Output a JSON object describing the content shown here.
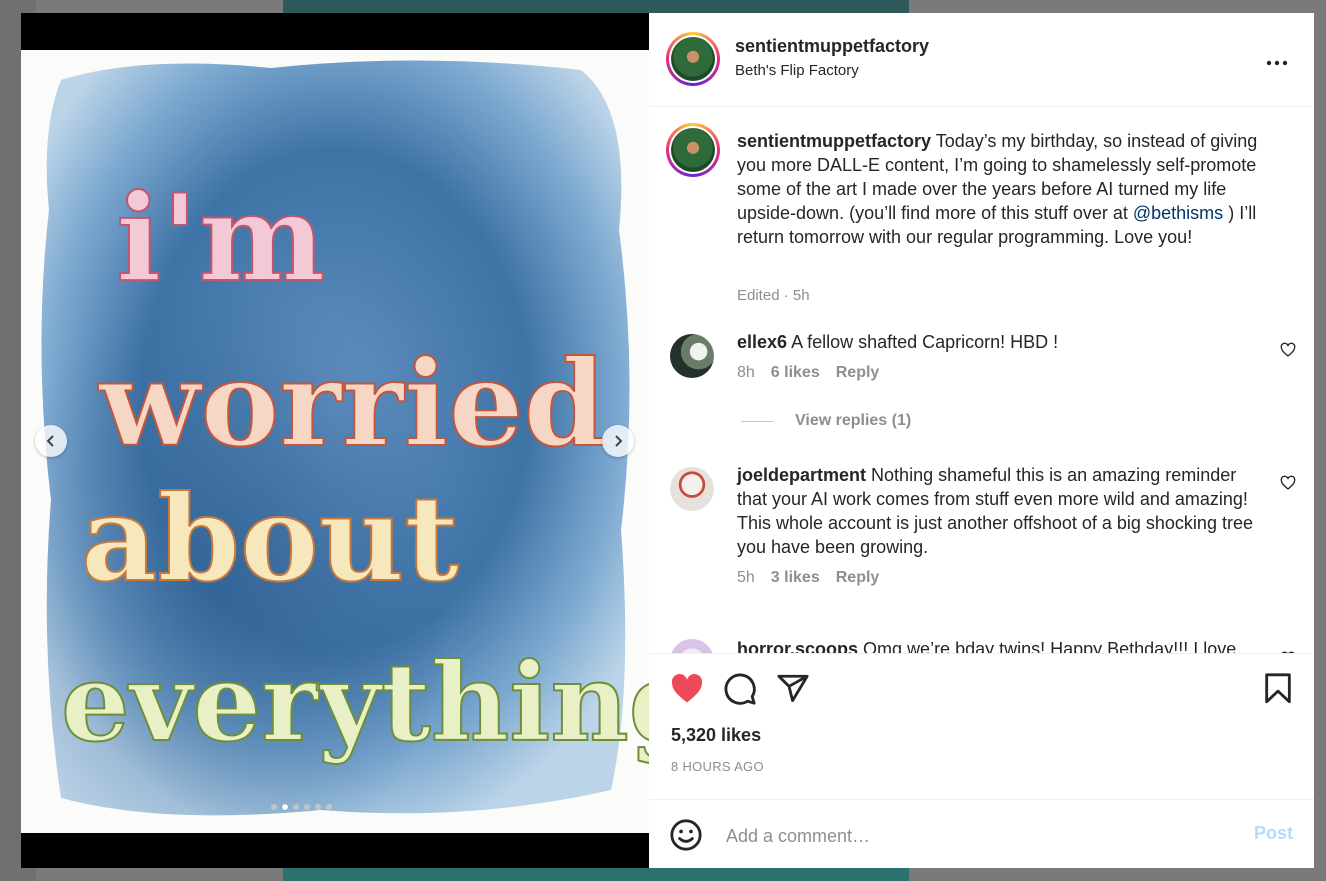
{
  "post": {
    "username": "sentientmuppetfactory",
    "subtitle": "Beth's Flip Factory",
    "more_icon": "more-horizontal-icon"
  },
  "caption": {
    "username": "sentientmuppetfactory",
    "text_before": "Today’s my birthday, so instead of giving you more DALL-E content, I’m going to shamelessly self-promote some of the art I made over the years before AI turned my life upside-down. (you’ll find more of this stuff over at",
    "mention": "@bethisms",
    "text_after": ") I’ll return tomorrow with our regular programming. Love you!",
    "meta": "Edited · 5h"
  },
  "comments": [
    {
      "username": "ellex6",
      "text": "A fellow shafted Capricorn! HBD !",
      "time": "8h",
      "likes": "6 likes",
      "reply": "Reply",
      "view_replies": "View replies (1)"
    },
    {
      "username": "joeldepartment",
      "text": "Nothing shameful this is an amazing reminder that your AI work comes from stuff even more wild and amazing! This whole account is just another offshoot of a big shocking tree you have been growing.",
      "time": "5h",
      "likes": "3 likes",
      "reply": "Reply"
    },
    {
      "username": "horror.scoops",
      "text": "Omg we’re bday twins! Happy Bethday!!! I love"
    }
  ],
  "actions": {
    "likes": "5,320 likes",
    "time_ago": "8 HOURS AGO",
    "liked": true,
    "like_color": "#ed4956"
  },
  "add_comment": {
    "placeholder": "Add a comment…",
    "post_label": "Post"
  },
  "artwork": {
    "lines": [
      "i'm",
      "worried",
      "about",
      "everything"
    ]
  },
  "carousel": {
    "total": 6,
    "active": 1
  }
}
